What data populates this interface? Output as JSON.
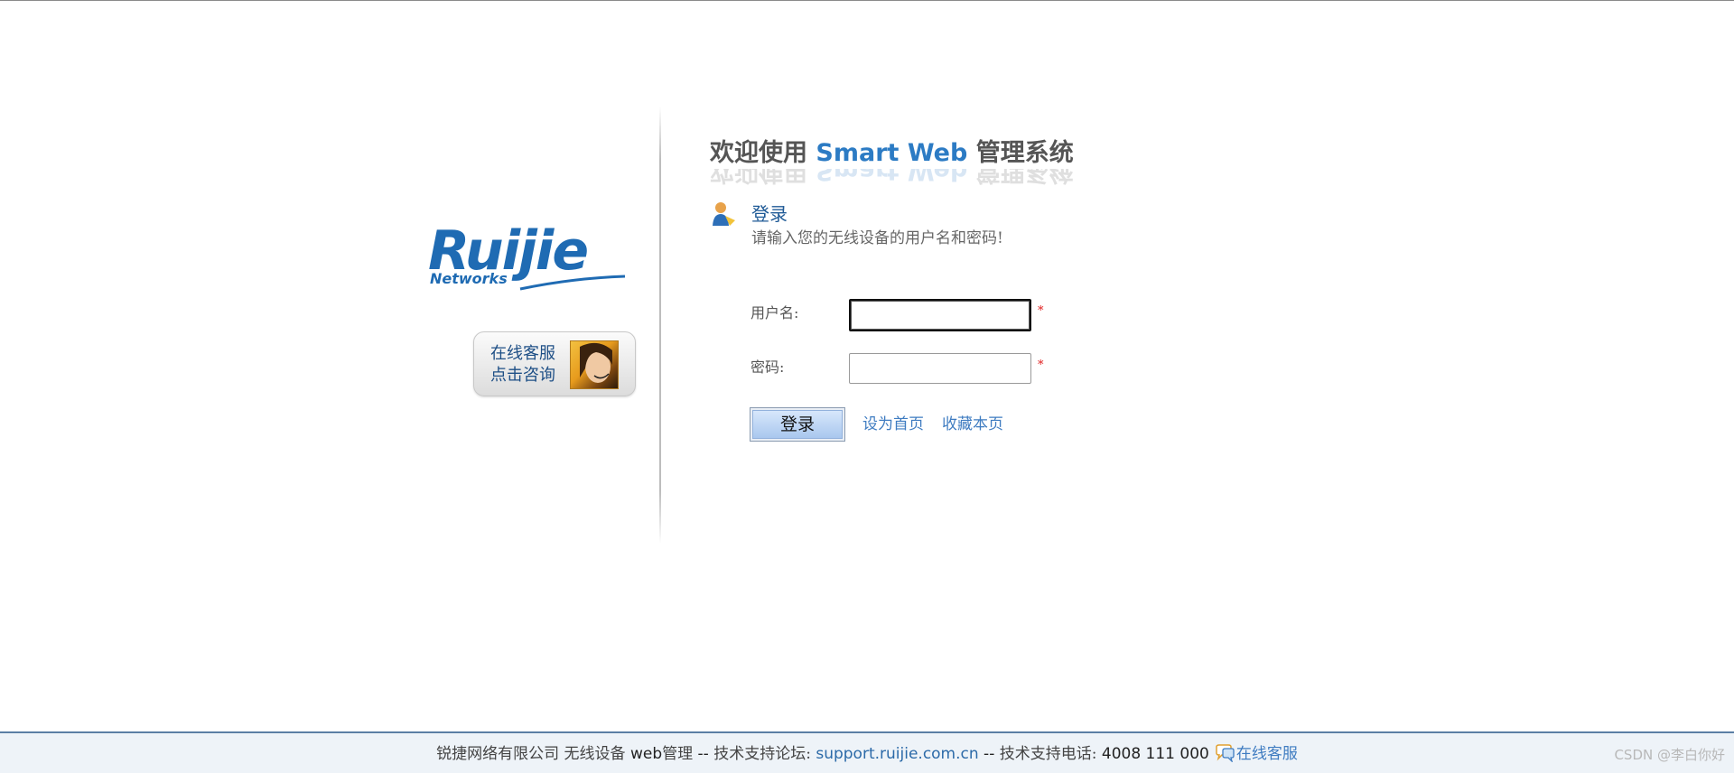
{
  "brand": {
    "logo_word": "Ruijie",
    "logo_sub": "Networks",
    "brand_blue": "#1f6bb3"
  },
  "online_service_badge": {
    "line1": "在线客服",
    "line2": "点击咨询"
  },
  "title": {
    "prefix": "欢迎使用 ",
    "smart": "Smart",
    "web": "Web",
    "suffix": "管理系统"
  },
  "login": {
    "heading": "登录",
    "hint": "请输入您的无线设备的用户名和密码!",
    "username_label": "用户名:",
    "password_label": "密码:",
    "username_value": "",
    "password_value": "",
    "required_mark": "*",
    "submit_label": "登录",
    "set_home_link": "设为首页",
    "bookmark_link": "收藏本页"
  },
  "footer": {
    "company": "锐捷网络有限公司 无线设备 ",
    "web": "web",
    "mgmt": "管理 ",
    "dash1": "-- ",
    "forum_label": "技术支持论坛: ",
    "forum_link": "support.ruijie.com.cn",
    "dash2": " -- ",
    "phone_label": "技术支持电话: ",
    "phone": "4008 111 000",
    "online_service": "在线客服",
    "watermark": "CSDN @李白你好"
  },
  "colors": {
    "footer_border": "#5b7fa5",
    "link": "#3f7cc1",
    "required": "#e02020"
  }
}
